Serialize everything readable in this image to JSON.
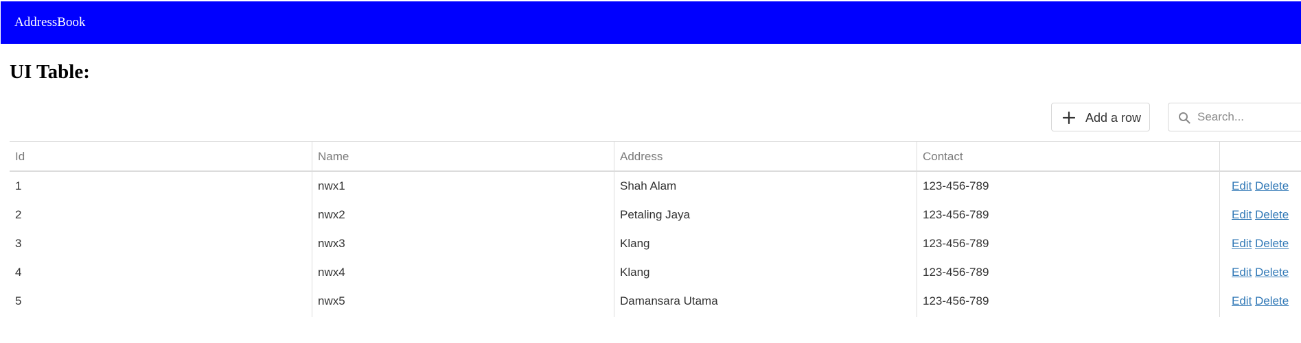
{
  "navbar": {
    "brand": "AddressBook",
    "background_color": "#0000ff"
  },
  "page": {
    "title": "UI Table:"
  },
  "toolbar": {
    "add_row_label": "Add a row",
    "add_row_icon": "plus-icon",
    "search_icon": "search-icon",
    "search_placeholder": "Search...",
    "search_value": ""
  },
  "table": {
    "columns": [
      "Id",
      "Name",
      "Address",
      "Contact",
      ""
    ],
    "rows": [
      {
        "id": "1",
        "name": "nwx1",
        "address": "Shah Alam",
        "contact": "123-456-789",
        "edit": "Edit",
        "delete": "Delete"
      },
      {
        "id": "2",
        "name": "nwx2",
        "address": "Petaling Jaya",
        "contact": "123-456-789",
        "edit": "Edit",
        "delete": "Delete"
      },
      {
        "id": "3",
        "name": "nwx3",
        "address": "Klang",
        "contact": "123-456-789",
        "edit": "Edit",
        "delete": "Delete"
      },
      {
        "id": "4",
        "name": "nwx4",
        "address": "Klang",
        "contact": "123-456-789",
        "edit": "Edit",
        "delete": "Delete"
      },
      {
        "id": "5",
        "name": "nwx5",
        "address": "Damansara Utama",
        "contact": "123-456-789",
        "edit": "Edit",
        "delete": "Delete"
      }
    ],
    "link_color": "#337ab7"
  }
}
